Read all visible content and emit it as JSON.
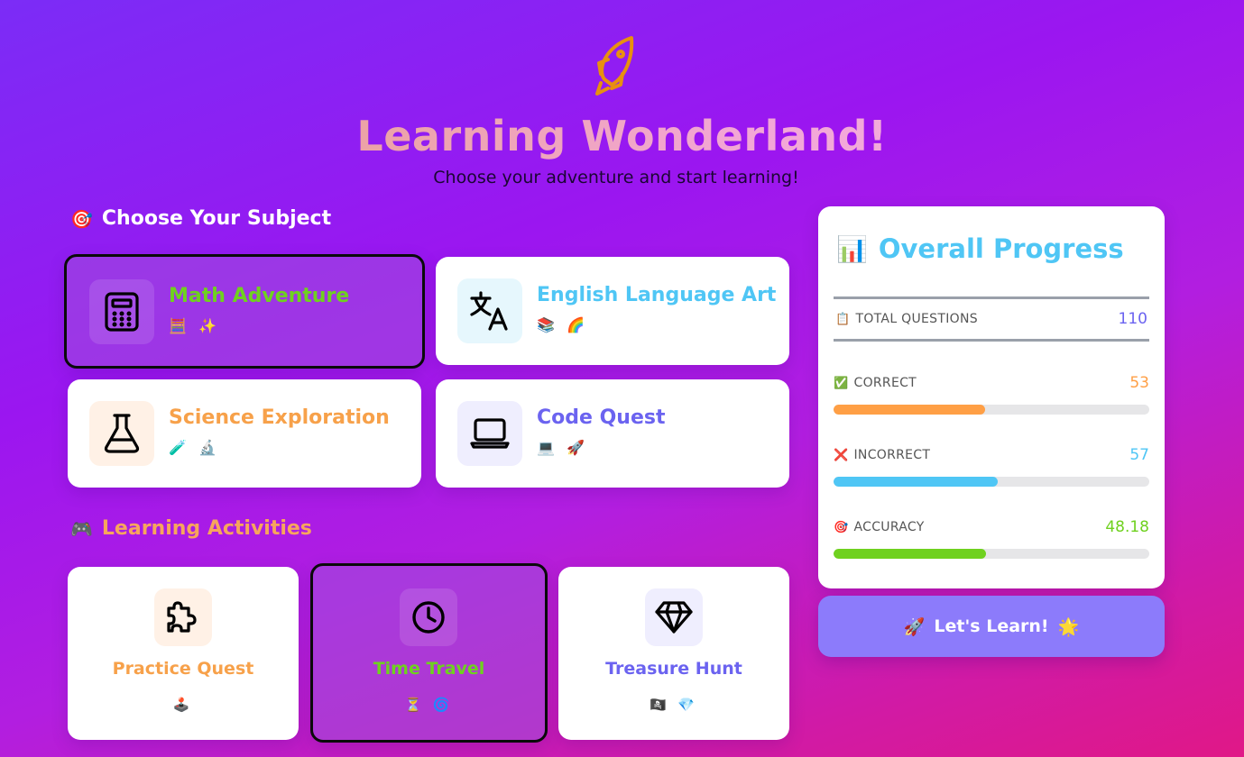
{
  "header": {
    "icon": "rocket-icon",
    "title": "Learning Wonderland!",
    "subtitle": "Choose your adventure and start learning!"
  },
  "subjects_section": {
    "emoji": "🎯",
    "heading": "Choose Your Subject",
    "items": [
      {
        "title": "Math Adventure",
        "emojis": "🧮 ✨",
        "icon": "calculator-icon",
        "color": "#6fd11f",
        "icon_bg": "rgba(255,255,255,0.12)",
        "selected": true
      },
      {
        "title": "English Language Art",
        "emojis": "📚 🌈",
        "icon": "translate-icon",
        "color": "#4fc6f5",
        "icon_bg": "#e6f7fd",
        "selected": false
      },
      {
        "title": "Science Exploration",
        "emojis": "🧪 🔬",
        "icon": "flask-icon",
        "color": "#f7a14a",
        "icon_bg": "#fff1e6",
        "selected": false
      },
      {
        "title": "Code Quest",
        "emojis": "💻 🚀",
        "icon": "laptop-icon",
        "color": "#6b63f0",
        "icon_bg": "#efeefe",
        "selected": false
      }
    ]
  },
  "activities_section": {
    "emoji": "🎮",
    "heading": "Learning Activities",
    "items": [
      {
        "title": "Practice Quest",
        "emojis": "🕹️",
        "icon": "puzzle-icon",
        "color": "#f7a14a",
        "icon_bg": "#fff1e6",
        "selected": false
      },
      {
        "title": "Time Travel",
        "emojis": "⏳ 🌀",
        "icon": "clock-icon",
        "color": "#6fd11f",
        "icon_bg": "rgba(255,255,255,0.12)",
        "selected": true
      },
      {
        "title": "Treasure Hunt",
        "emojis": "🏴‍☠️ 💎",
        "icon": "diamond-icon",
        "color": "#6b63f0",
        "icon_bg": "#efeefe",
        "selected": false
      }
    ]
  },
  "progress": {
    "emoji": "📊",
    "title": "Overall Progress",
    "total": {
      "emoji": "📋",
      "label": "TOTAL QUESTIONS",
      "value": "110",
      "color": "#6b63f0"
    },
    "stats": [
      {
        "emoji": "✅",
        "label": "CORRECT",
        "value": "53",
        "color": "#ff9f45",
        "fraction": 0.48
      },
      {
        "emoji": "❌",
        "label": "INCORRECT",
        "value": "57",
        "color": "#4fc6f5",
        "fraction": 0.52
      },
      {
        "emoji": "🎯",
        "label": "ACCURACY",
        "value": "48.18",
        "color": "#6fd11f",
        "fraction": 0.4818
      }
    ]
  },
  "action_button": {
    "left_emoji": "🚀",
    "label": "Let's Learn!",
    "right_emoji": "🌟"
  }
}
